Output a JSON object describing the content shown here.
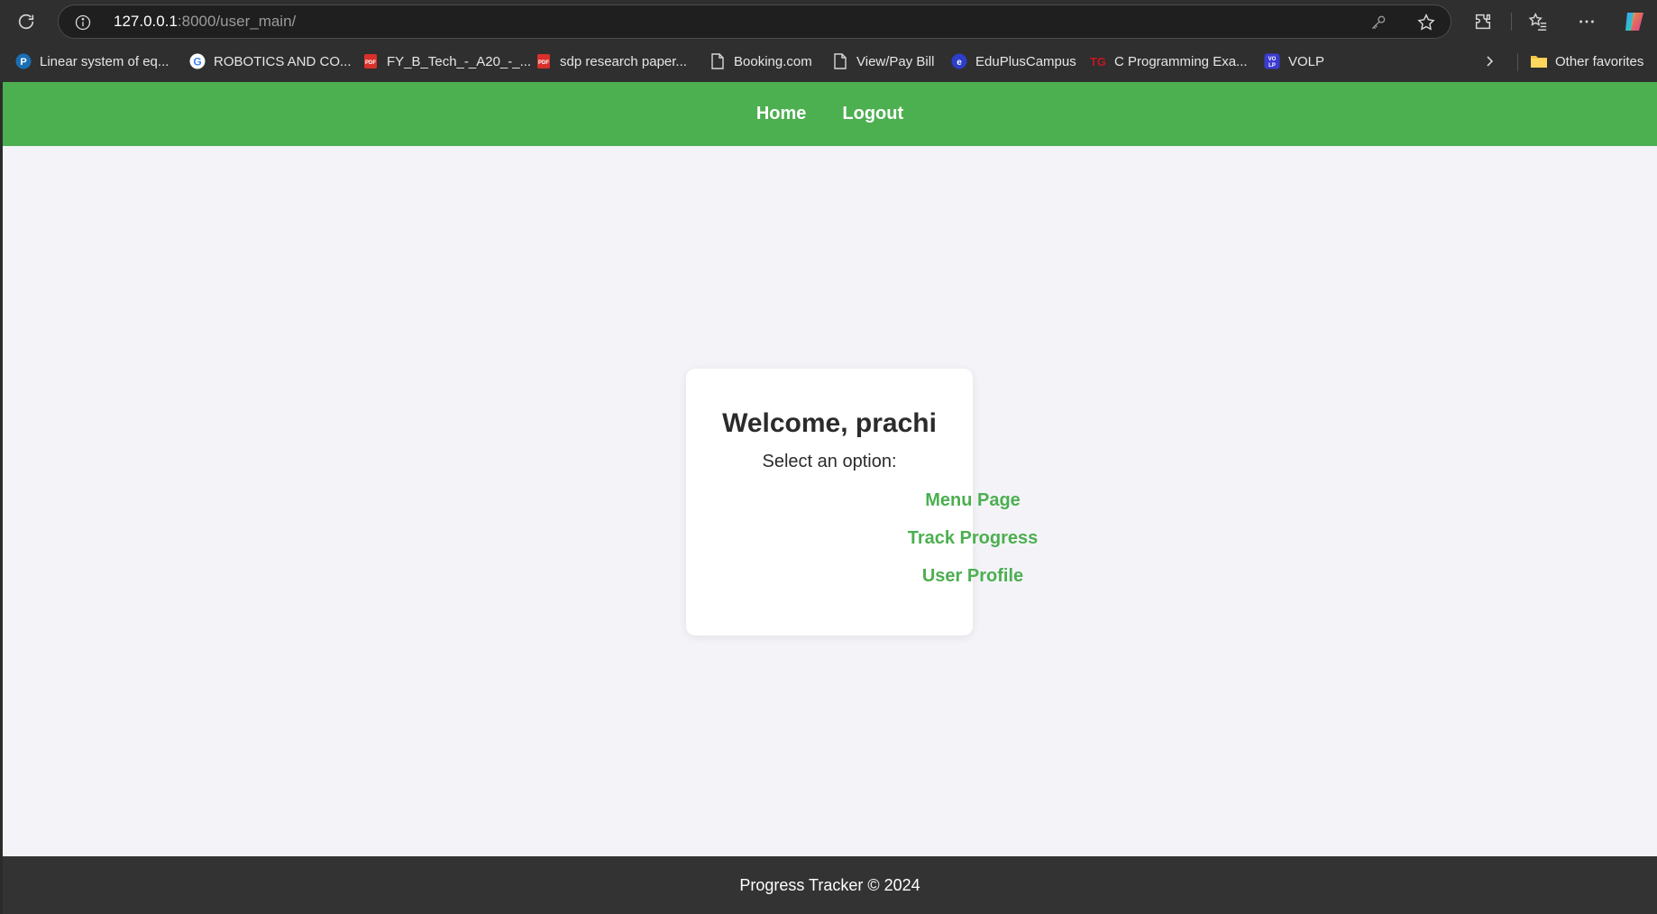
{
  "browser": {
    "url_host": "127.0.0.1",
    "url_rest": ":8000/user_main/",
    "bookmarks": [
      {
        "label": "Linear system of eq...",
        "icon": "pearson-icon"
      },
      {
        "label": "ROBOTICS AND CO...",
        "icon": "google-icon"
      },
      {
        "label": "FY_B_Tech_-_A20_-_...",
        "icon": "pdf-icon"
      },
      {
        "label": "sdp research paper...",
        "icon": "pdf-icon"
      },
      {
        "label": "Booking.com",
        "icon": "page-icon"
      },
      {
        "label": "View/Pay Bill",
        "icon": "page-icon"
      },
      {
        "label": "EduPlusCampus",
        "icon": "edupluscampus-icon"
      },
      {
        "label": "C Programming Exa...",
        "icon": "tg-icon"
      },
      {
        "label": "VOLP",
        "icon": "volp-icon"
      }
    ],
    "other_favorites": "Other favorites"
  },
  "nav": {
    "home": "Home",
    "logout": "Logout"
  },
  "card": {
    "title": "Welcome, prachi",
    "subtitle": "Select an option:",
    "options": [
      "Menu Page",
      "Track Progress",
      "User Profile"
    ]
  },
  "footer": {
    "text": "Progress Tracker © 2024"
  },
  "colors": {
    "accent": "#4caf50",
    "footer_bg": "#333333",
    "page_bg": "#f4f4f8"
  }
}
